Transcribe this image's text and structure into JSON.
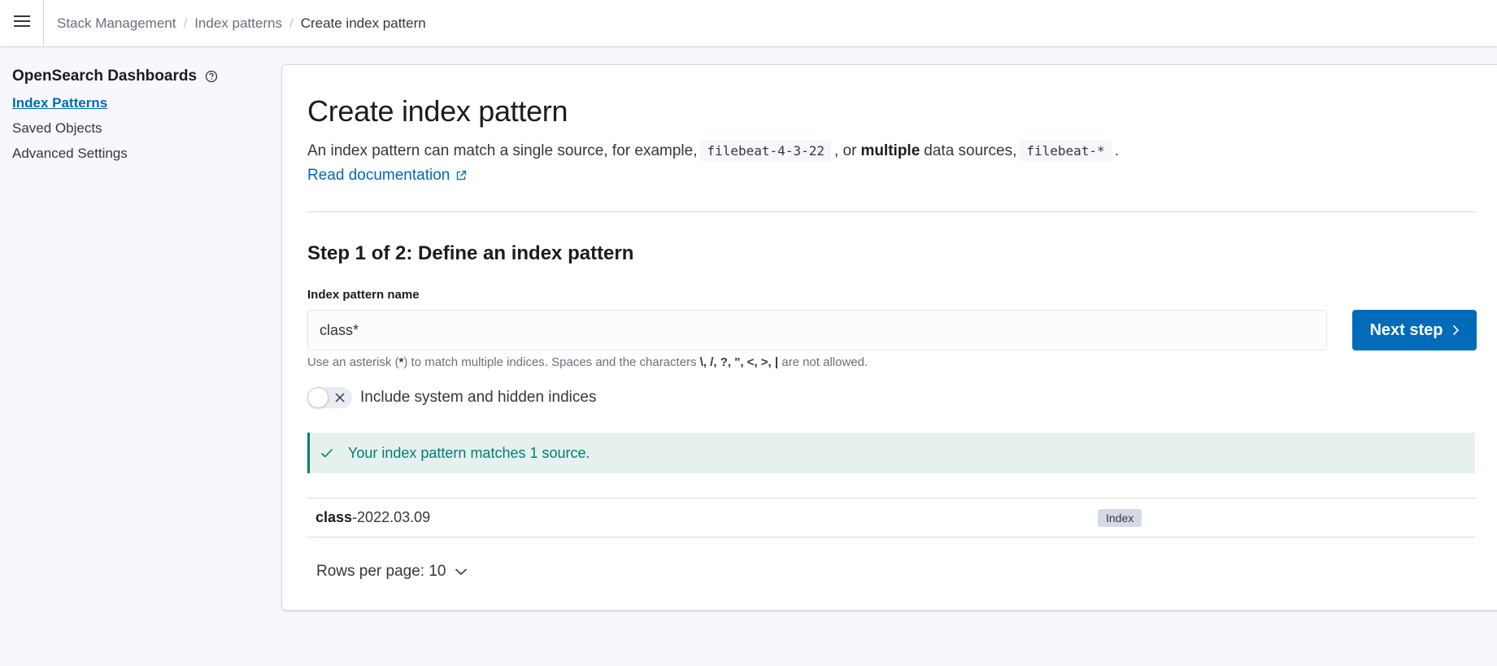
{
  "header": {
    "breadcrumbs": [
      "Stack Management",
      "Index patterns",
      "Create index pattern"
    ],
    "separator": "/"
  },
  "sidebar": {
    "title": "OpenSearch Dashboards",
    "items": [
      {
        "label": "Index Patterns",
        "active": true
      },
      {
        "label": "Saved Objects",
        "active": false
      },
      {
        "label": "Advanced Settings",
        "active": false
      }
    ]
  },
  "main": {
    "title": "Create index pattern",
    "desc_part1": "An index pattern can match a single source, for example,",
    "code1": "filebeat-4-3-22",
    "desc_part2": ", or",
    "desc_bold": "multiple",
    "desc_part3": "data sources,",
    "code2": "filebeat-*",
    "desc_part4": ".",
    "doc_link": "Read documentation",
    "step_title": "Step 1 of 2: Define an index pattern",
    "field_label": "Index pattern name",
    "input_value": "class*",
    "next_button": "Next step",
    "help_prefix": "Use an asterisk (",
    "help_asterisk": "*",
    "help_mid": ") to match multiple indices. Spaces and the characters ",
    "help_chars": "\\, /, ?, \", <, >, |",
    "help_suffix": " are not allowed.",
    "toggle_label": "Include system and hidden indices",
    "toggle_on": false,
    "callout": "Your index pattern matches 1 source.",
    "table": {
      "rows": [
        {
          "name_bold": "class",
          "name_rest": "-2022.03.09",
          "badge": "Index"
        }
      ]
    },
    "rows_per_page": "Rows per page: 10"
  },
  "colors": {
    "accent": "#006bb8",
    "success": "#017d73",
    "success_bg": "#e6f1ee"
  }
}
